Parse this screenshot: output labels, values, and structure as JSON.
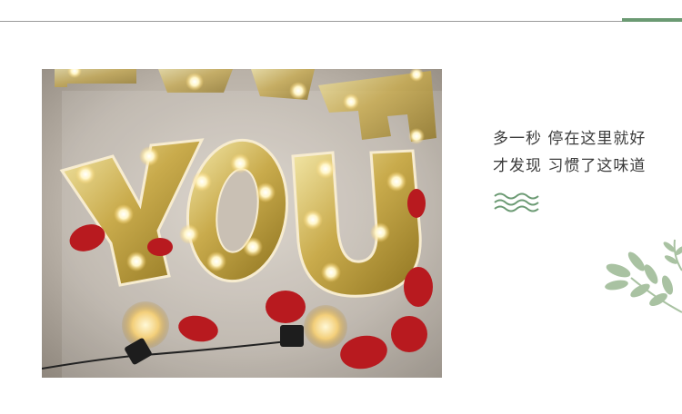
{
  "banner": {
    "accent_color": "#6b9a73",
    "rule_color": "#9a9a9a"
  },
  "photo": {
    "subject": "marquee-letters-photo",
    "letters_back_row": [
      "L",
      "O",
      "V",
      "E"
    ],
    "letters_front_row": [
      "Y",
      "O",
      "U"
    ]
  },
  "tagline": {
    "line1": "多一秒 停在这里就好",
    "line2": "才发现 习惯了这味道"
  },
  "decor": {
    "wave_icon": "wavy-lines-icon",
    "leaf_icon": "leaf-branch-icon",
    "leaf_color": "#a9c2a2"
  }
}
